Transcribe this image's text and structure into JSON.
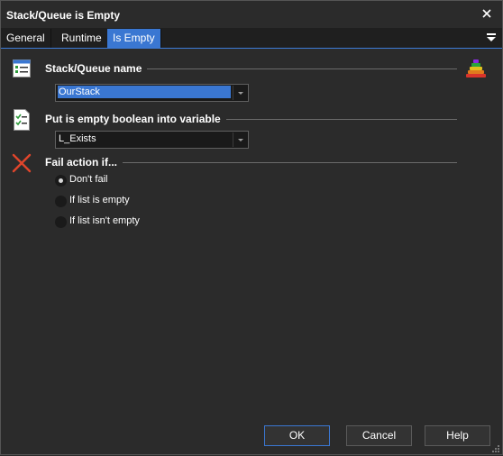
{
  "window": {
    "title": "Stack/Queue is Empty"
  },
  "tabs": [
    {
      "label": "General"
    },
    {
      "label": "Runtime"
    },
    {
      "label": "Is Empty"
    }
  ],
  "sections": {
    "stack_queue": {
      "title": "Stack/Queue name",
      "value": "OurStack"
    },
    "boolean_var": {
      "title": "Put is empty boolean into variable",
      "value": "L_Exists"
    },
    "fail_action": {
      "title": "Fail action if...",
      "options": [
        {
          "label": "Don't fail",
          "checked": true
        },
        {
          "label": "If list is empty",
          "checked": false
        },
        {
          "label": "If list isn't empty",
          "checked": false
        }
      ]
    }
  },
  "buttons": {
    "ok": "OK",
    "cancel": "Cancel",
    "help": "Help"
  },
  "colors": {
    "accent": "#3a77d2",
    "background": "#2b2b2b",
    "fail_icon": "#e0452b"
  }
}
